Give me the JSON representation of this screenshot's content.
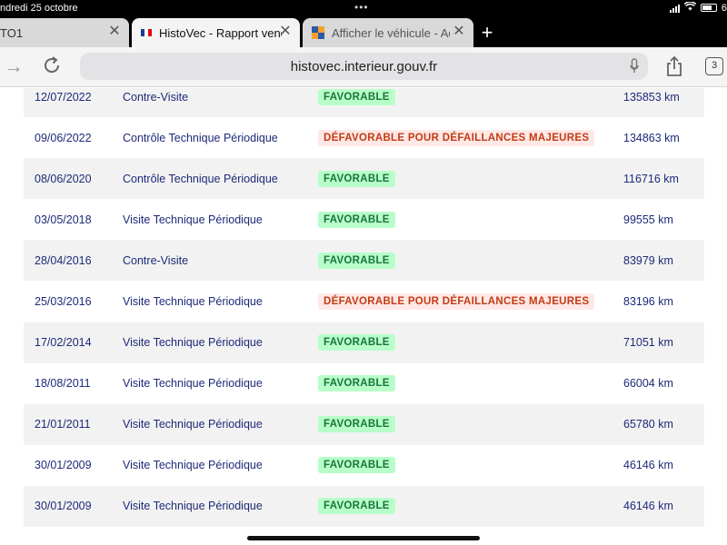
{
  "status_bar": {
    "time": "ndredi 25 octobre",
    "dots": "•••",
    "battery_text": "6"
  },
  "tabs": [
    {
      "title": "TO1",
      "close": "✕"
    },
    {
      "title": "HistoVec - Rapport vendeur",
      "close": "✕",
      "flag_colors": [
        "#1b3e93",
        "#ffffff",
        "#e1000f"
      ]
    },
    {
      "title": "Afficher le véhicule - Adm",
      "close": "✕"
    }
  ],
  "new_tab_icon": "+",
  "toolbar": {
    "back_icon": "←",
    "forward_icon": "→",
    "reload_icon": "↻",
    "url": "histovec.interieur.gouv.fr",
    "share_icon": "share-icon",
    "tab_count": "3"
  },
  "table": {
    "rows": [
      {
        "date": "12/07/2022",
        "type": "Contre-Visite",
        "result": "FAVORABLE",
        "status": "ok",
        "km": "135853 km"
      },
      {
        "date": "09/06/2022",
        "type": "Contrôle Technique Périodique",
        "result": "DÉFAVORABLE POUR DÉFAILLANCES MAJEURES",
        "status": "ko",
        "km": "134863 km"
      },
      {
        "date": "08/06/2020",
        "type": "Contrôle Technique Périodique",
        "result": "FAVORABLE",
        "status": "ok",
        "km": "116716 km"
      },
      {
        "date": "03/05/2018",
        "type": "Visite Technique Périodique",
        "result": "FAVORABLE",
        "status": "ok",
        "km": "99555 km"
      },
      {
        "date": "28/04/2016",
        "type": "Contre-Visite",
        "result": "FAVORABLE",
        "status": "ok",
        "km": "83979 km"
      },
      {
        "date": "25/03/2016",
        "type": "Visite Technique Périodique",
        "result": "DÉFAVORABLE POUR DÉFAILLANCES MAJEURES",
        "status": "ko",
        "km": "83196 km"
      },
      {
        "date": "17/02/2014",
        "type": "Visite Technique Périodique",
        "result": "FAVORABLE",
        "status": "ok",
        "km": "71051 km"
      },
      {
        "date": "18/08/2011",
        "type": "Visite Technique Périodique",
        "result": "FAVORABLE",
        "status": "ok",
        "km": "66004 km"
      },
      {
        "date": "21/01/2011",
        "type": "Visite Technique Périodique",
        "result": "FAVORABLE",
        "status": "ok",
        "km": "65780 km"
      },
      {
        "date": "30/01/2009",
        "type": "Visite Technique Périodique",
        "result": "FAVORABLE",
        "status": "ok",
        "km": "46146 km"
      },
      {
        "date": "30/01/2009",
        "type": "Visite Technique Périodique",
        "result": "FAVORABLE",
        "status": "ok",
        "km": "46146 km"
      }
    ]
  },
  "colors": {
    "text_blue": "#1e2a78",
    "favorable_bg": "#b8fec9",
    "favorable_text": "#18753c",
    "defavorable_bg": "#ffe9e6",
    "defavorable_text": "#c33b14",
    "row_alt": "#f2f2f2"
  }
}
